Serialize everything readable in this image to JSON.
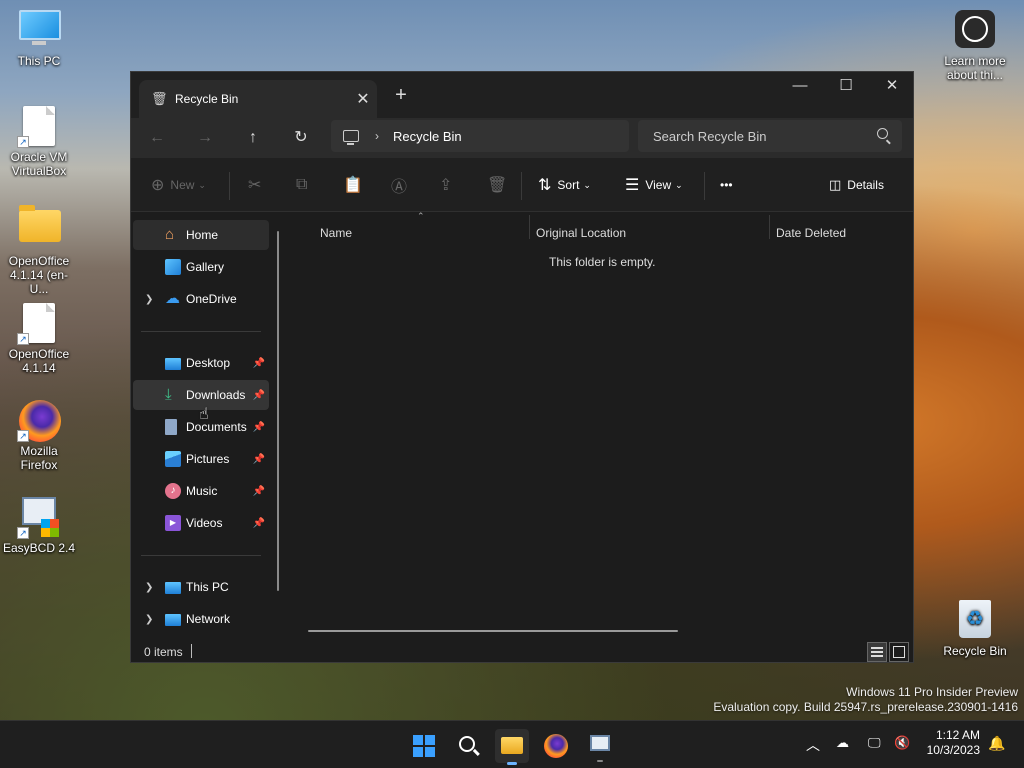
{
  "desktop": {
    "icons": [
      {
        "label": "This PC"
      },
      {
        "label": "Oracle VM VirtualBox"
      },
      {
        "label": "OpenOffice 4.1.14 (en-U..."
      },
      {
        "label": "OpenOffice 4.1.14"
      },
      {
        "label": "Mozilla Firefox"
      },
      {
        "label": "EasyBCD 2.4"
      },
      {
        "label": "Learn more about thi..."
      },
      {
        "label": "Recycle Bin"
      }
    ],
    "watermark": {
      "line1": "Windows 11 Pro Insider Preview",
      "line2": "Evaluation copy. Build 25947.rs_prerelease.230901-1416"
    }
  },
  "window": {
    "tab_title": "Recycle Bin",
    "new_tab": "+",
    "address": {
      "location": "Recycle Bin",
      "chevron": "›"
    },
    "search": {
      "placeholder": "Search Recycle Bin"
    },
    "commands": {
      "new": "New",
      "sort": "Sort",
      "view": "View",
      "more": "•••",
      "details": "Details"
    },
    "sidebar": {
      "items": [
        {
          "label": "Home"
        },
        {
          "label": "Gallery"
        },
        {
          "label": "OneDrive"
        },
        {
          "label": "Desktop"
        },
        {
          "label": "Downloads"
        },
        {
          "label": "Documents"
        },
        {
          "label": "Pictures"
        },
        {
          "label": "Music"
        },
        {
          "label": "Videos"
        },
        {
          "label": "This PC"
        },
        {
          "label": "Network"
        }
      ]
    },
    "columns": [
      "Name",
      "Original Location",
      "Date Deleted"
    ],
    "empty_message": "This folder is empty.",
    "status": {
      "count": "0 items"
    }
  },
  "taskbar": {
    "clock": {
      "time": "1:12 AM",
      "date": "10/3/2023"
    }
  },
  "colors": {
    "accent": "#6cb4ff",
    "window_bg": "#1c1c1c",
    "titlebar": "#202020"
  }
}
